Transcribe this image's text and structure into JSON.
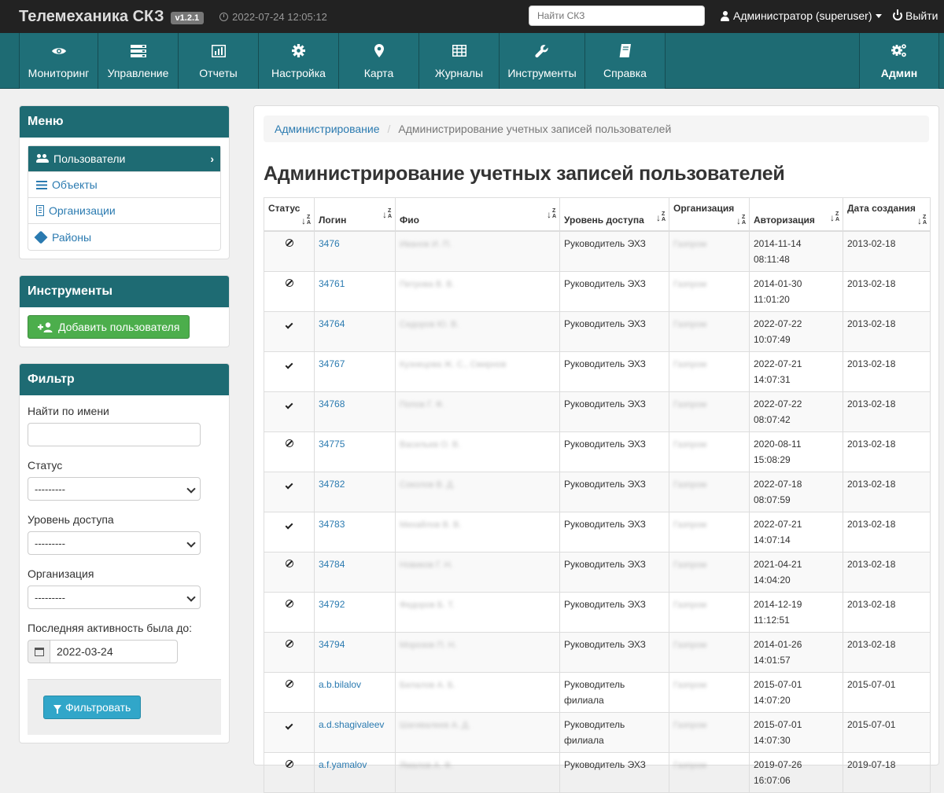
{
  "app": {
    "brand": "Телемеханика СКЗ",
    "version": "v1.2.1",
    "datetime": "2022-07-24 12:05:12",
    "search_placeholder": "Найти СКЗ",
    "user": "Администратор (superuser)",
    "logout": "Выйти"
  },
  "nav": {
    "items": [
      {
        "label": "Мониторинг",
        "icon": "eye-icon"
      },
      {
        "label": "Управление",
        "icon": "server-icon"
      },
      {
        "label": "Отчеты",
        "icon": "bar-chart-icon"
      },
      {
        "label": "Настройка",
        "icon": "gear-icon"
      },
      {
        "label": "Карта",
        "icon": "map-marker-icon"
      },
      {
        "label": "Журналы",
        "icon": "table-icon"
      },
      {
        "label": "Инструменты",
        "icon": "wrench-icon"
      },
      {
        "label": "Справка",
        "icon": "book-icon"
      }
    ],
    "admin": {
      "label": "Админ",
      "icon": "gears-icon"
    }
  },
  "sidebar": {
    "menu": {
      "title": "Меню",
      "items": [
        {
          "label": "Пользователи",
          "icon": "users-icon",
          "active": true
        },
        {
          "label": "Объекты",
          "icon": "list-icon"
        },
        {
          "label": "Организации",
          "icon": "building-icon"
        },
        {
          "label": "Районы",
          "icon": "tag-icon"
        }
      ]
    },
    "tools": {
      "title": "Инструменты",
      "add_user": "Добавить пользователя"
    },
    "filter": {
      "title": "Фильтр",
      "name_label": "Найти по имени",
      "name_value": "",
      "status_label": "Статус",
      "status_value": "---------",
      "access_label": "Уровень доступа",
      "access_value": "---------",
      "org_label": "Организация",
      "org_value": "---------",
      "activity_label": "Последняя активность была до:",
      "activity_value": "2022-03-24",
      "submit": "Фильтровать"
    }
  },
  "main": {
    "breadcrumb": {
      "root": "Администрирование",
      "current": "Администрирование учетных записей пользователей"
    },
    "title": "Администрирование учетных записей пользователей",
    "columns": {
      "status": "Статус",
      "login": "Логин",
      "fio": "Фио",
      "access": "Уровень доступа",
      "org": "Организация",
      "auth": "Авторизация",
      "created": "Дата создания"
    },
    "rows": [
      {
        "status": "blocked",
        "login": "3476",
        "fio": "Иванов И. П.",
        "access": "Руководитель ЭХЗ",
        "org": "Газпром",
        "auth1": "2014-11-14",
        "auth2": "08:11:48",
        "created": "2013-02-18"
      },
      {
        "status": "blocked",
        "login": "34761",
        "fio": "Петрова В. В.",
        "access": "Руководитель ЭХЗ",
        "org": "Газпром",
        "auth1": "2014-01-30",
        "auth2": "11:01:20",
        "created": "2013-02-18"
      },
      {
        "status": "active",
        "login": "34764",
        "fio": "Сидоров Ю. В.",
        "access": "Руководитель ЭХЗ",
        "org": "Газпром",
        "auth1": "2022-07-22",
        "auth2": "10:07:49",
        "created": "2013-02-18"
      },
      {
        "status": "active",
        "login": "34767",
        "fio": "Кузнецова Ж. С., Смирнов",
        "access": "Руководитель ЭХЗ",
        "org": "Газпром",
        "auth1": "2022-07-21",
        "auth2": "14:07:31",
        "created": "2013-02-18"
      },
      {
        "status": "active",
        "login": "34768",
        "fio": "Попов Г. Ф.",
        "access": "Руководитель ЭХЗ",
        "org": "Газпром",
        "auth1": "2022-07-22",
        "auth2": "08:07:42",
        "created": "2013-02-18"
      },
      {
        "status": "blocked",
        "login": "34775",
        "fio": "Васильев О. В.",
        "access": "Руководитель ЭХЗ",
        "org": "Газпром",
        "auth1": "2020-08-11",
        "auth2": "15:08:29",
        "created": "2013-02-18"
      },
      {
        "status": "active",
        "login": "34782",
        "fio": "Соколов В. Д.",
        "access": "Руководитель ЭХЗ",
        "org": "Газпром",
        "auth1": "2022-07-18",
        "auth2": "08:07:59",
        "created": "2013-02-18"
      },
      {
        "status": "active",
        "login": "34783",
        "fio": "Михайлов В. В.",
        "access": "Руководитель ЭХЗ",
        "org": "Газпром",
        "auth1": "2022-07-21",
        "auth2": "14:07:14",
        "created": "2013-02-18"
      },
      {
        "status": "blocked",
        "login": "34784",
        "fio": "Новиков Г. Н.",
        "access": "Руководитель ЭХЗ",
        "org": "Газпром",
        "auth1": "2021-04-21",
        "auth2": "14:04:20",
        "created": "2013-02-18"
      },
      {
        "status": "blocked",
        "login": "34792",
        "fio": "Федоров Б. Т.",
        "access": "Руководитель ЭХЗ",
        "org": "Газпром",
        "auth1": "2014-12-19",
        "auth2": "11:12:51",
        "created": "2013-02-18"
      },
      {
        "status": "blocked",
        "login": "34794",
        "fio": "Морозов П. Н.",
        "access": "Руководитель ЭХЗ",
        "org": "Газпром",
        "auth1": "2014-01-26",
        "auth2": "14:01:57",
        "created": "2013-02-18"
      },
      {
        "status": "blocked",
        "login": "a.b.bilalov",
        "fio": "Билалов А. Б.",
        "access": "Руководитель филиала",
        "org": "Газпром",
        "auth1": "2015-07-01",
        "auth2": "14:07:20",
        "created": "2015-07-01"
      },
      {
        "status": "active",
        "login": "a.d.shagivaleev",
        "fio": "Шагивалеев А. Д.",
        "access": "Руководитель филиала",
        "org": "Газпром",
        "auth1": "2015-07-01",
        "auth2": "14:07:30",
        "created": "2015-07-01"
      },
      {
        "status": "blocked",
        "login": "a.f.yamalov",
        "fio": "Ямалов А. Ф.",
        "access": "Руководитель ЭХЗ",
        "org": "Газпром",
        "auth1": "2019-07-26",
        "auth2": "16:07:06",
        "created": "2019-07-18"
      }
    ]
  }
}
